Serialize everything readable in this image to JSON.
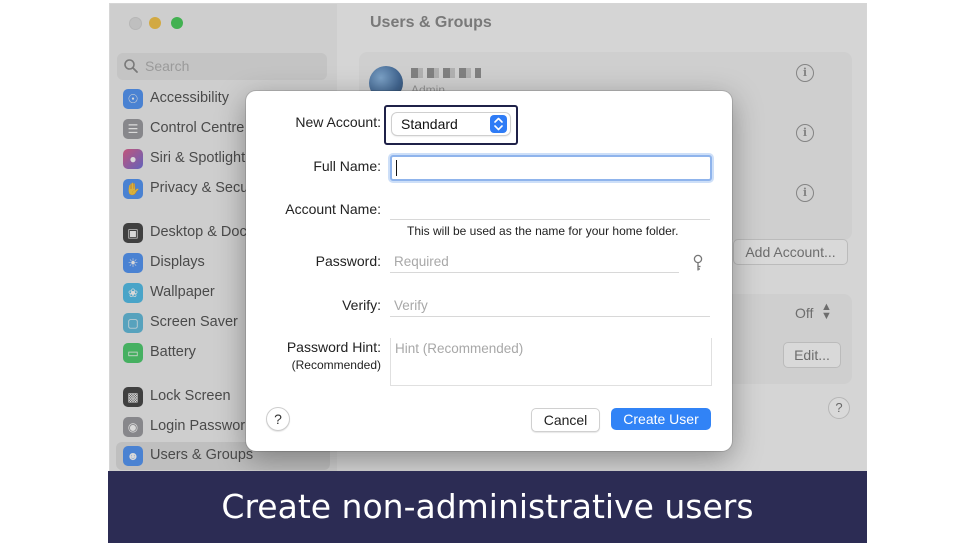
{
  "sidebar": {
    "search_placeholder": "Search",
    "items": [
      {
        "label": "Accessibility",
        "icon": "accessibility-icon",
        "color": "#3a87f5"
      },
      {
        "label": "Control Centre",
        "icon": "control-centre-icon",
        "color": "#8e8e93"
      },
      {
        "label": "Siri & Spotlight",
        "icon": "siri-icon",
        "color": "#c24ca8"
      },
      {
        "label": "Privacy & Secu",
        "icon": "hand-icon",
        "color": "#3a87f5"
      },
      {
        "label": "Desktop & Doc",
        "icon": "desktop-icon",
        "color": "#2b2b2b"
      },
      {
        "label": "Displays",
        "icon": "displays-icon",
        "color": "#3a87f5"
      },
      {
        "label": "Wallpaper",
        "icon": "wallpaper-icon",
        "color": "#38b6e8"
      },
      {
        "label": "Screen Saver",
        "icon": "screen-saver-icon",
        "color": "#4cb3d8"
      },
      {
        "label": "Battery",
        "icon": "battery-icon",
        "color": "#34c759"
      },
      {
        "label": "Lock Screen",
        "icon": "lock-icon",
        "color": "#2b2b2b"
      },
      {
        "label": "Login Passwor",
        "icon": "login-password-icon",
        "color": "#8e8e93"
      },
      {
        "label": "Users & Groups",
        "icon": "users-icon",
        "color": "#3a87f5"
      }
    ]
  },
  "main": {
    "title": "Users & Groups",
    "user_role": "Admin",
    "add_account_label": "Add Account...",
    "auto_login_value": "Off",
    "edit_label": "Edit..."
  },
  "dialog": {
    "new_account_label": "New Account:",
    "account_type_value": "Standard",
    "full_name_label": "Full Name:",
    "account_name_label": "Account Name:",
    "account_name_note": "This will be used as the name for your home folder.",
    "password_label": "Password:",
    "password_placeholder": "Required",
    "verify_label": "Verify:",
    "verify_placeholder": "Verify",
    "hint_label": "Password Hint:",
    "hint_sublabel": "(Recommended)",
    "hint_placeholder": "Hint (Recommended)",
    "help_label": "?",
    "cancel_label": "Cancel",
    "create_label": "Create User",
    "accent_color": "#3183f6"
  },
  "banner": {
    "text": "Create non-administrative users",
    "color": "#2c2c54"
  }
}
